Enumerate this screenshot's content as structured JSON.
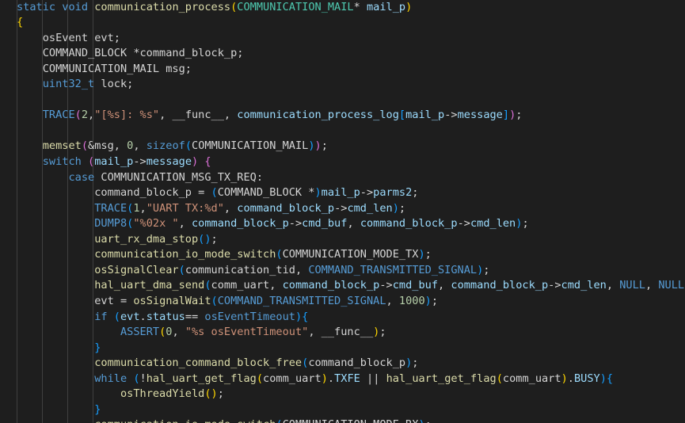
{
  "editor": {
    "lines": [
      [
        [
          "kw",
          "static"
        ],
        [
          "pl",
          " "
        ],
        [
          "kw",
          "void"
        ],
        [
          "pl",
          " "
        ],
        [
          "fn",
          "communication_process"
        ],
        [
          "br1",
          "("
        ],
        [
          "ty",
          "COMMUNICATION_MAIL"
        ],
        [
          "pl",
          "* "
        ],
        [
          "vr",
          "mail_p"
        ],
        [
          "br1",
          ")"
        ]
      ],
      [
        [
          "br1",
          "{"
        ]
      ],
      [
        [
          "pl",
          "    osEvent evt;"
        ]
      ],
      [
        [
          "pl",
          "    COMMAND_BLOCK *command_block_p;"
        ]
      ],
      [
        [
          "pl",
          "    COMMUNICATION_MAIL msg;"
        ]
      ],
      [
        [
          "pl",
          "    "
        ],
        [
          "kw",
          "uint32_t"
        ],
        [
          "pl",
          " lock;"
        ]
      ],
      [
        [
          "pl",
          ""
        ]
      ],
      [
        [
          "pl",
          "    "
        ],
        [
          "kw",
          "TRACE"
        ],
        [
          "br2",
          "("
        ],
        [
          "nm",
          "2"
        ],
        [
          "pl",
          ","
        ],
        [
          "st",
          "\"[%s]: %s\""
        ],
        [
          "pl",
          ", __func__, "
        ],
        [
          "vr",
          "communication_process_log"
        ],
        [
          "br3",
          "["
        ],
        [
          "vr",
          "mail_p"
        ],
        [
          "pl",
          "->"
        ],
        [
          "vr",
          "message"
        ],
        [
          "br3",
          "]"
        ],
        [
          "br2",
          ")"
        ],
        [
          "pl",
          ";"
        ]
      ],
      [
        [
          "pl",
          ""
        ]
      ],
      [
        [
          "pl",
          "    "
        ],
        [
          "fn",
          "memset"
        ],
        [
          "br2",
          "("
        ],
        [
          "pl",
          "&msg, "
        ],
        [
          "nm",
          "0"
        ],
        [
          "pl",
          ", "
        ],
        [
          "kw",
          "sizeof"
        ],
        [
          "br3",
          "("
        ],
        [
          "pl",
          "COMMUNICATION_MAIL"
        ],
        [
          "br3",
          ")"
        ],
        [
          "br2",
          ")"
        ],
        [
          "pl",
          ";"
        ]
      ],
      [
        [
          "pl",
          "    "
        ],
        [
          "kw",
          "switch"
        ],
        [
          "pl",
          " "
        ],
        [
          "br2",
          "("
        ],
        [
          "vr",
          "mail_p"
        ],
        [
          "pl",
          "->"
        ],
        [
          "vr",
          "message"
        ],
        [
          "br2",
          ")"
        ],
        [
          "pl",
          " "
        ],
        [
          "br2",
          "{"
        ]
      ],
      [
        [
          "pl",
          "        "
        ],
        [
          "kw",
          "case"
        ],
        [
          "pl",
          " COMMUNICATION_MSG_TX_REQ:"
        ]
      ],
      [
        [
          "pl",
          "            command_block_p = "
        ],
        [
          "br3",
          "("
        ],
        [
          "pl",
          "COMMAND_BLOCK *"
        ],
        [
          "br3",
          ")"
        ],
        [
          "vr",
          "mail_p"
        ],
        [
          "pl",
          "->"
        ],
        [
          "vr",
          "parms2"
        ],
        [
          "pl",
          ";"
        ]
      ],
      [
        [
          "pl",
          "            "
        ],
        [
          "kw",
          "TRACE"
        ],
        [
          "br3",
          "("
        ],
        [
          "nm",
          "1"
        ],
        [
          "pl",
          ","
        ],
        [
          "st",
          "\"UART TX:%d\""
        ],
        [
          "pl",
          ", "
        ],
        [
          "vr",
          "command_block_p"
        ],
        [
          "pl",
          "->"
        ],
        [
          "vr",
          "cmd_len"
        ],
        [
          "br3",
          ")"
        ],
        [
          "pl",
          ";"
        ]
      ],
      [
        [
          "pl",
          "            "
        ],
        [
          "kw",
          "DUMP8"
        ],
        [
          "br3",
          "("
        ],
        [
          "st",
          "\"%02x \""
        ],
        [
          "pl",
          ", "
        ],
        [
          "vr",
          "command_block_p"
        ],
        [
          "pl",
          "->"
        ],
        [
          "vr",
          "cmd_buf"
        ],
        [
          "pl",
          ", "
        ],
        [
          "vr",
          "command_block_p"
        ],
        [
          "pl",
          "->"
        ],
        [
          "vr",
          "cmd_len"
        ],
        [
          "br3",
          ")"
        ],
        [
          "pl",
          ";"
        ]
      ],
      [
        [
          "pl",
          "            "
        ],
        [
          "fn",
          "uart_rx_dma_stop"
        ],
        [
          "br3",
          "()"
        ],
        [
          "pl",
          ";"
        ]
      ],
      [
        [
          "pl",
          "            "
        ],
        [
          "fn",
          "communication_io_mode_switch"
        ],
        [
          "br3",
          "("
        ],
        [
          "pl",
          "COMMUNICATION_MODE_TX"
        ],
        [
          "br3",
          ")"
        ],
        [
          "pl",
          ";"
        ]
      ],
      [
        [
          "pl",
          "            "
        ],
        [
          "fn",
          "osSignalClear"
        ],
        [
          "br3",
          "("
        ],
        [
          "pl",
          "communication_tid, "
        ],
        [
          "kw",
          "COMMAND_TRANSMITTED_SIGNAL"
        ],
        [
          "br3",
          ")"
        ],
        [
          "pl",
          ";"
        ]
      ],
      [
        [
          "pl",
          "            "
        ],
        [
          "fn",
          "hal_uart_dma_send"
        ],
        [
          "br3",
          "("
        ],
        [
          "pl",
          "comm_uart, "
        ],
        [
          "vr",
          "command_block_p"
        ],
        [
          "pl",
          "->"
        ],
        [
          "vr",
          "cmd_buf"
        ],
        [
          "pl",
          ", "
        ],
        [
          "vr",
          "command_block_p"
        ],
        [
          "pl",
          "->"
        ],
        [
          "vr",
          "cmd_len"
        ],
        [
          "pl",
          ", "
        ],
        [
          "kw",
          "NULL"
        ],
        [
          "pl",
          ", "
        ],
        [
          "kw",
          "NULL"
        ],
        [
          "br3",
          ")"
        ],
        [
          "pl",
          ";"
        ]
      ],
      [
        [
          "pl",
          "            evt = "
        ],
        [
          "fn",
          "osSignalWait"
        ],
        [
          "br3",
          "("
        ],
        [
          "kw",
          "COMMAND_TRANSMITTED_SIGNAL"
        ],
        [
          "pl",
          ", "
        ],
        [
          "nm",
          "1000"
        ],
        [
          "br3",
          ")"
        ],
        [
          "pl",
          ";"
        ]
      ],
      [
        [
          "pl",
          "            "
        ],
        [
          "kw",
          "if"
        ],
        [
          "pl",
          " "
        ],
        [
          "br3",
          "("
        ],
        [
          "vr",
          "evt"
        ],
        [
          "pl",
          "."
        ],
        [
          "vr",
          "status"
        ],
        [
          "pl",
          "== "
        ],
        [
          "kw",
          "osEventTimeout"
        ],
        [
          "br3",
          ")"
        ],
        [
          "br3",
          "{"
        ]
      ],
      [
        [
          "pl",
          "                "
        ],
        [
          "kw",
          "ASSERT"
        ],
        [
          "br1",
          "("
        ],
        [
          "nm",
          "0"
        ],
        [
          "pl",
          ", "
        ],
        [
          "st",
          "\"%s osEventTimeout\""
        ],
        [
          "pl",
          ", __func__"
        ],
        [
          "br1",
          ")"
        ],
        [
          "pl",
          ";"
        ]
      ],
      [
        [
          "pl",
          "            "
        ],
        [
          "br3",
          "}"
        ]
      ],
      [
        [
          "pl",
          "            "
        ],
        [
          "fn",
          "communication_command_block_free"
        ],
        [
          "br3",
          "("
        ],
        [
          "pl",
          "command_block_p"
        ],
        [
          "br3",
          ")"
        ],
        [
          "pl",
          ";"
        ]
      ],
      [
        [
          "pl",
          "            "
        ],
        [
          "kw",
          "while"
        ],
        [
          "pl",
          " "
        ],
        [
          "br3",
          "("
        ],
        [
          "pl",
          "!"
        ],
        [
          "fn",
          "hal_uart_get_flag"
        ],
        [
          "br1",
          "("
        ],
        [
          "pl",
          "comm_uart"
        ],
        [
          "br1",
          ")"
        ],
        [
          "pl",
          "."
        ],
        [
          "vr",
          "TXFE"
        ],
        [
          "pl",
          " || "
        ],
        [
          "fn",
          "hal_uart_get_flag"
        ],
        [
          "br1",
          "("
        ],
        [
          "pl",
          "comm_uart"
        ],
        [
          "br1",
          ")"
        ],
        [
          "pl",
          "."
        ],
        [
          "vr",
          "BUSY"
        ],
        [
          "br3",
          ")"
        ],
        [
          "br3",
          "{"
        ]
      ],
      [
        [
          "pl",
          "                "
        ],
        [
          "fn",
          "osThreadYield"
        ],
        [
          "br1",
          "()"
        ],
        [
          "pl",
          ";"
        ]
      ],
      [
        [
          "pl",
          "            "
        ],
        [
          "br3",
          "}"
        ]
      ],
      [
        [
          "pl",
          "            "
        ],
        [
          "fn",
          "communication_io_mode_switch"
        ],
        [
          "br3",
          "("
        ],
        [
          "pl",
          "COMMUNICATION_MODE_RX"
        ],
        [
          "br3",
          ")"
        ],
        [
          "pl",
          ";"
        ]
      ]
    ]
  }
}
